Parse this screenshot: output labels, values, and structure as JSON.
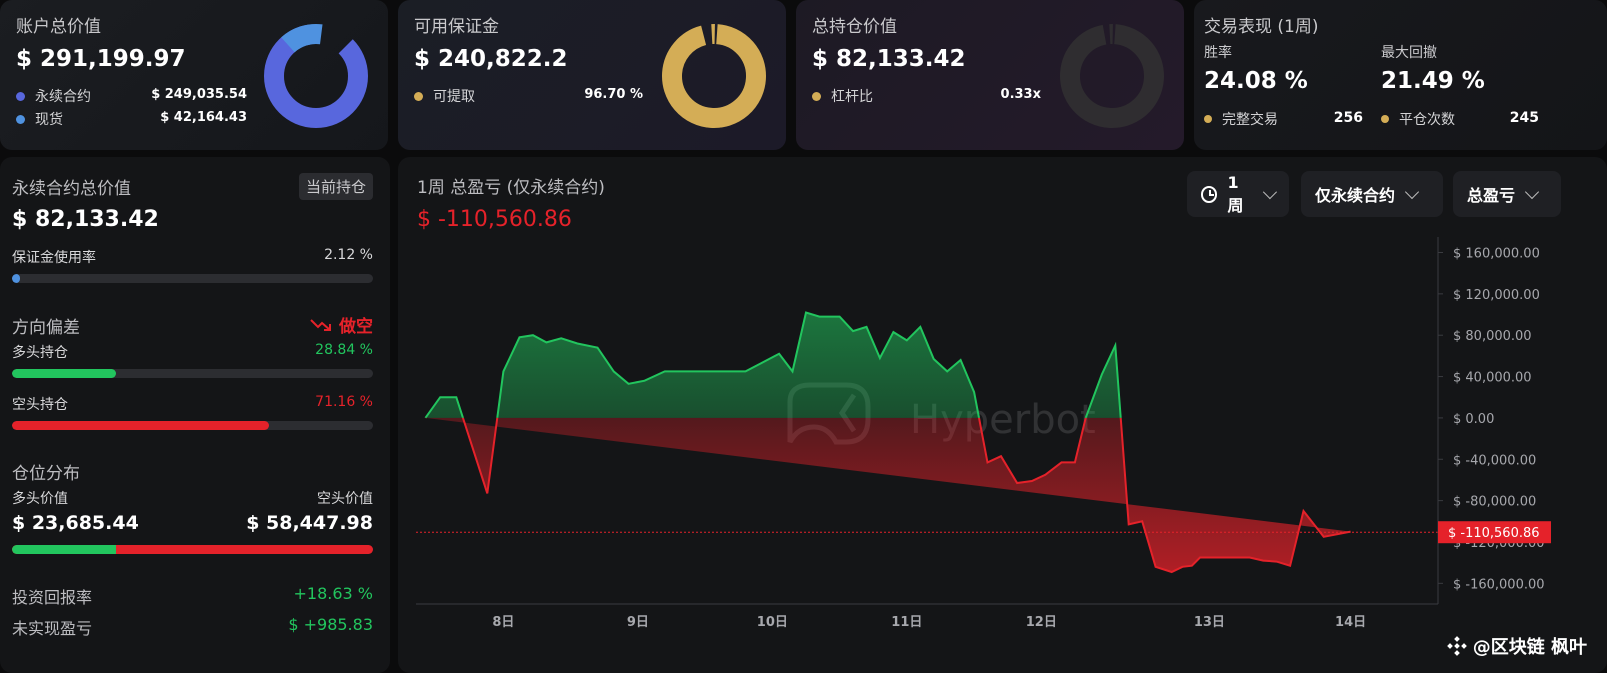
{
  "account": {
    "title": "账户总价值",
    "value": "$ 291,199.97",
    "legend": [
      {
        "label": "永续合约",
        "value": "$ 249,035.54",
        "color": "#5867dd"
      },
      {
        "label": "现货",
        "value": "$ 42,164.43",
        "color": "#4f92e0"
      }
    ],
    "donut": {
      "segments": [
        {
          "fraction": 0.855,
          "color": "#5867dd"
        },
        {
          "fraction": 0.145,
          "color": "#4f92e0"
        }
      ]
    }
  },
  "margin": {
    "title": "可用保证金",
    "value": "$ 240,822.2",
    "legend_label": "可提取",
    "legend_value": "96.70 %",
    "color": "#d4ad56",
    "fraction": 0.967
  },
  "position": {
    "title": "总持仓价值",
    "value": "$ 82,133.42",
    "legend_label": "杠杆比",
    "legend_value": "0.33x",
    "color": "#d4ad56",
    "fraction": 0.0
  },
  "performance": {
    "title": "交易表现 (1周)",
    "win_rate_label": "胜率",
    "win_rate": "24.08 %",
    "max_dd_label": "最大回撤",
    "max_dd": "21.49 %",
    "complete_trades_label": "完整交易",
    "complete_trades": "256",
    "close_count_label": "平仓次数",
    "close_count": "245"
  },
  "perp": {
    "title": "永续合约总价值",
    "tag": "当前持仓",
    "value": "$ 82,133.42",
    "margin_usage_label": "保证金使用率",
    "margin_usage": "2.12 %",
    "margin_usage_fraction": 0.0212,
    "bias_label": "方向偏差",
    "bias_value": "做空",
    "long_label": "多头持仓",
    "long_pct": "28.84 %",
    "long_fraction": 0.2884,
    "short_label": "空头持仓",
    "short_pct": "71.16 %",
    "short_fraction": 0.7116,
    "dist_label": "仓位分布",
    "long_value_label": "多头价值",
    "short_value_label": "空头价值",
    "long_value": "$ 23,685.44",
    "short_value": "$ 58,447.98",
    "roi_label": "投资回报率",
    "roi": "+18.63 %",
    "unrealized_label": "未实现盈亏",
    "unrealized": "$ +985.83",
    "colors": {
      "green": "#22c55e",
      "red": "#e5222a"
    }
  },
  "chart": {
    "title": "1周 总盈亏 (仅永续合约)",
    "pnl": "$ -110,560.86",
    "filters": {
      "period": "1周",
      "scope": "仅永续合约",
      "metric": "总盈亏"
    },
    "watermark": "Hyperbot",
    "brand": "@区块链 枫叶"
  },
  "chart_data": {
    "type": "area",
    "title": "1周 总盈亏 (仅永续合约)",
    "x_ticks": [
      {
        "label": "8日",
        "x": 1
      },
      {
        "label": "9日",
        "x": 2
      },
      {
        "label": "10日",
        "x": 3
      },
      {
        "label": "11日",
        "x": 4
      },
      {
        "label": "12日",
        "x": 5
      },
      {
        "label": "13日",
        "x": 6.25
      },
      {
        "label": "14日",
        "x": 7.3
      }
    ],
    "xlim": [
      0.35,
      7.95
    ],
    "ylim": [
      -180000,
      175000
    ],
    "y_ticks": [
      160000,
      120000,
      80000,
      40000,
      0,
      -40000,
      -80000,
      -120000,
      -160000
    ],
    "y_tick_labels": [
      "$ 160,000.00",
      "$ 120,000.00",
      "$ 80,000.00",
      "$ 40,000.00",
      "$ 0.00",
      "$ -40,000.00",
      "$ -80,000.00",
      "$ -120,000.00",
      "$ -160,000.00"
    ],
    "current_value": -110560.86,
    "current_label": "$ -110,560.86",
    "colors": {
      "positive": "#22c55e",
      "negative": "#e5222a"
    },
    "x": [
      0.42,
      0.53,
      0.65,
      0.88,
      1.0,
      1.12,
      1.22,
      1.32,
      1.43,
      1.55,
      1.7,
      1.82,
      1.93,
      2.05,
      2.2,
      2.35,
      2.55,
      2.8,
      3.05,
      3.15,
      3.25,
      3.35,
      3.5,
      3.6,
      3.7,
      3.8,
      3.9,
      4.0,
      4.1,
      4.2,
      4.3,
      4.4,
      4.5,
      4.6,
      4.7,
      4.82,
      4.93,
      5.03,
      5.15,
      5.25,
      5.33,
      5.45,
      5.55,
      5.65,
      5.75,
      5.85,
      5.97,
      6.05,
      6.12,
      6.18,
      6.25,
      6.35,
      6.45,
      6.55,
      6.65,
      6.75,
      6.85,
      6.95,
      7.1,
      7.3,
      7.4,
      7.5,
      7.65,
      7.75,
      7.85
    ],
    "y": [
      0,
      20000,
      20000,
      -73000,
      45000,
      78000,
      80000,
      73000,
      77000,
      72000,
      68000,
      45000,
      33000,
      36000,
      45000,
      45000,
      45000,
      45000,
      62000,
      45000,
      102000,
      98000,
      98000,
      84000,
      88000,
      58000,
      83000,
      75000,
      88000,
      57000,
      45000,
      56000,
      25000,
      -43000,
      -37000,
      -63000,
      -61000,
      -55000,
      -43000,
      -43000,
      0,
      42000,
      70000,
      -103000,
      -100000,
      -144000,
      -149000,
      -144000,
      -143000,
      -135000,
      -135000,
      -135000,
      -135000,
      -135000,
      -138000,
      -139000,
      -143000,
      -90000,
      -115000,
      -110000
    ]
  }
}
